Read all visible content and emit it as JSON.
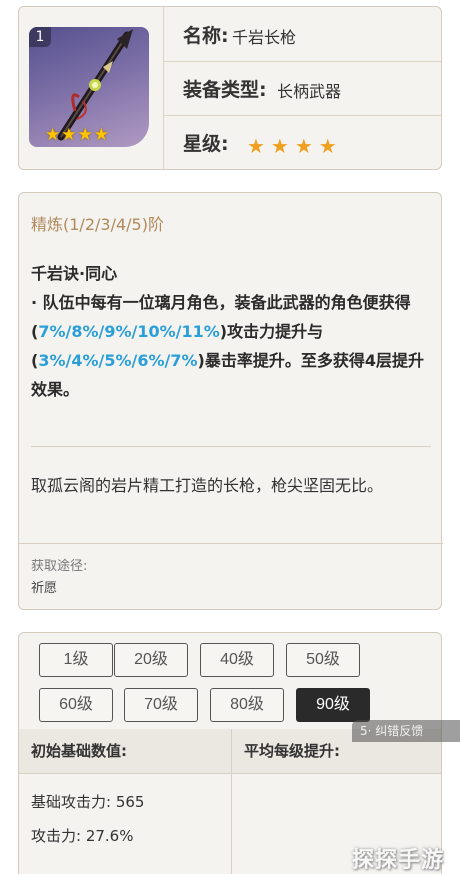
{
  "item": {
    "thumb_level": "1",
    "thumb_stars": "★★★★",
    "name_label": "名称:",
    "name_value": "千岩长枪",
    "type_label": "装备类型:",
    "type_value": "长柄武器",
    "rarity_label": "星级:",
    "rarity_stars": "★★★★",
    "rarity_count": 4
  },
  "details": {
    "refine_title": "精炼(1/2/3/4/5)阶",
    "skill_name": "千岩诀·同心",
    "skill_text_1": "· 队伍中每有一位璃月角色，装备此武器的角色便获得(",
    "skill_hl_1": "7%/8%/9%/10%/11%",
    "skill_text_2": ")攻击力提升与(",
    "skill_hl_2": "3%/4%/5%/6%/7%",
    "skill_text_3": ")暴击率提升。至多获得4层提升效果。",
    "lore": "取孤云阁的岩片精工打造的长枪，枪尖坚固无比。",
    "source_label": "获取途径:",
    "source_value": "祈愿"
  },
  "levels": {
    "buttons": [
      "1级",
      "20级",
      "40级",
      "50级",
      "60级",
      "70级",
      "80级",
      "90级"
    ],
    "selected": "90级"
  },
  "stats": {
    "col1_header": "初始基础数值:",
    "col2_header": "平均每级提升:",
    "base_atk": "基础攻击力: 565",
    "atk_percent": "攻击力: 27.6%"
  },
  "overlay": {
    "tag": "5·  纠错反馈",
    "watermark": "探探手游网"
  },
  "colors": {
    "accent_blue": "#2a9fd8",
    "refine_gold": "#b08a5c",
    "star": "#f0a020",
    "active_button": "#2a2a2a"
  }
}
